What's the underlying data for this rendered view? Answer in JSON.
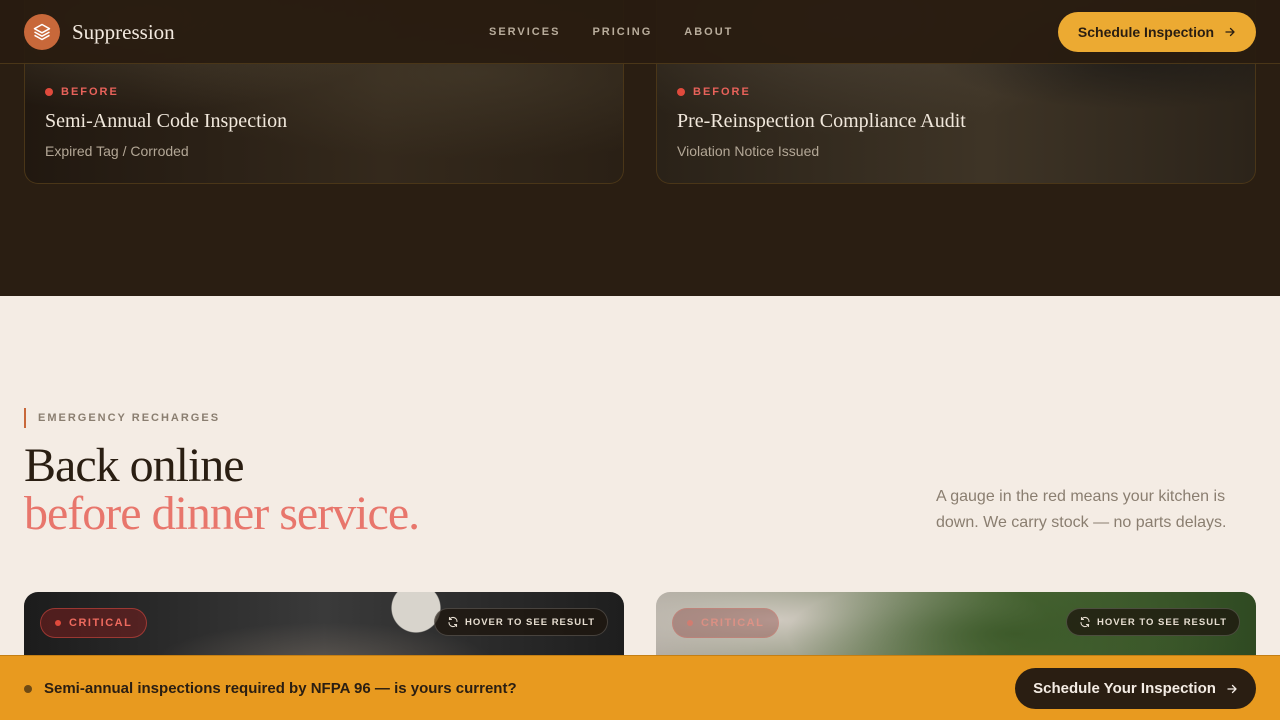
{
  "header": {
    "brand": "Suppression",
    "nav": [
      "SERVICES",
      "PRICING",
      "ABOUT"
    ],
    "cta_label": "Schedule Inspection"
  },
  "before_cards": [
    {
      "tag": "BEFORE",
      "title": "Semi-Annual Code Inspection",
      "subtitle": "Expired Tag / Corroded"
    },
    {
      "tag": "BEFORE",
      "title": "Pre-Reinspection Compliance Audit",
      "subtitle": "Violation Notice Issued"
    }
  ],
  "recharge": {
    "eyebrow": "EMERGENCY RECHARGES",
    "heading_line1": "Back online",
    "heading_line2": "before dinner service.",
    "lead": "A gauge in the red means your kitchen is down. We carry stock — no parts delays."
  },
  "critical_cards": [
    {
      "tag": "CRITICAL",
      "hover_label": "HOVER TO SEE RESULT"
    },
    {
      "tag": "CRITICAL",
      "hover_label": "HOVER TO SEE RESULT"
    }
  ],
  "sticky_bar": {
    "text": "Semi-annual inspections required by NFPA 96 — is yours current?",
    "cta_label": "Schedule Your Inspection"
  },
  "colors": {
    "accent": "#ecaa32",
    "dark": "#2a1e12",
    "critical": "#e04a3c",
    "highlight": "#e8766c"
  }
}
